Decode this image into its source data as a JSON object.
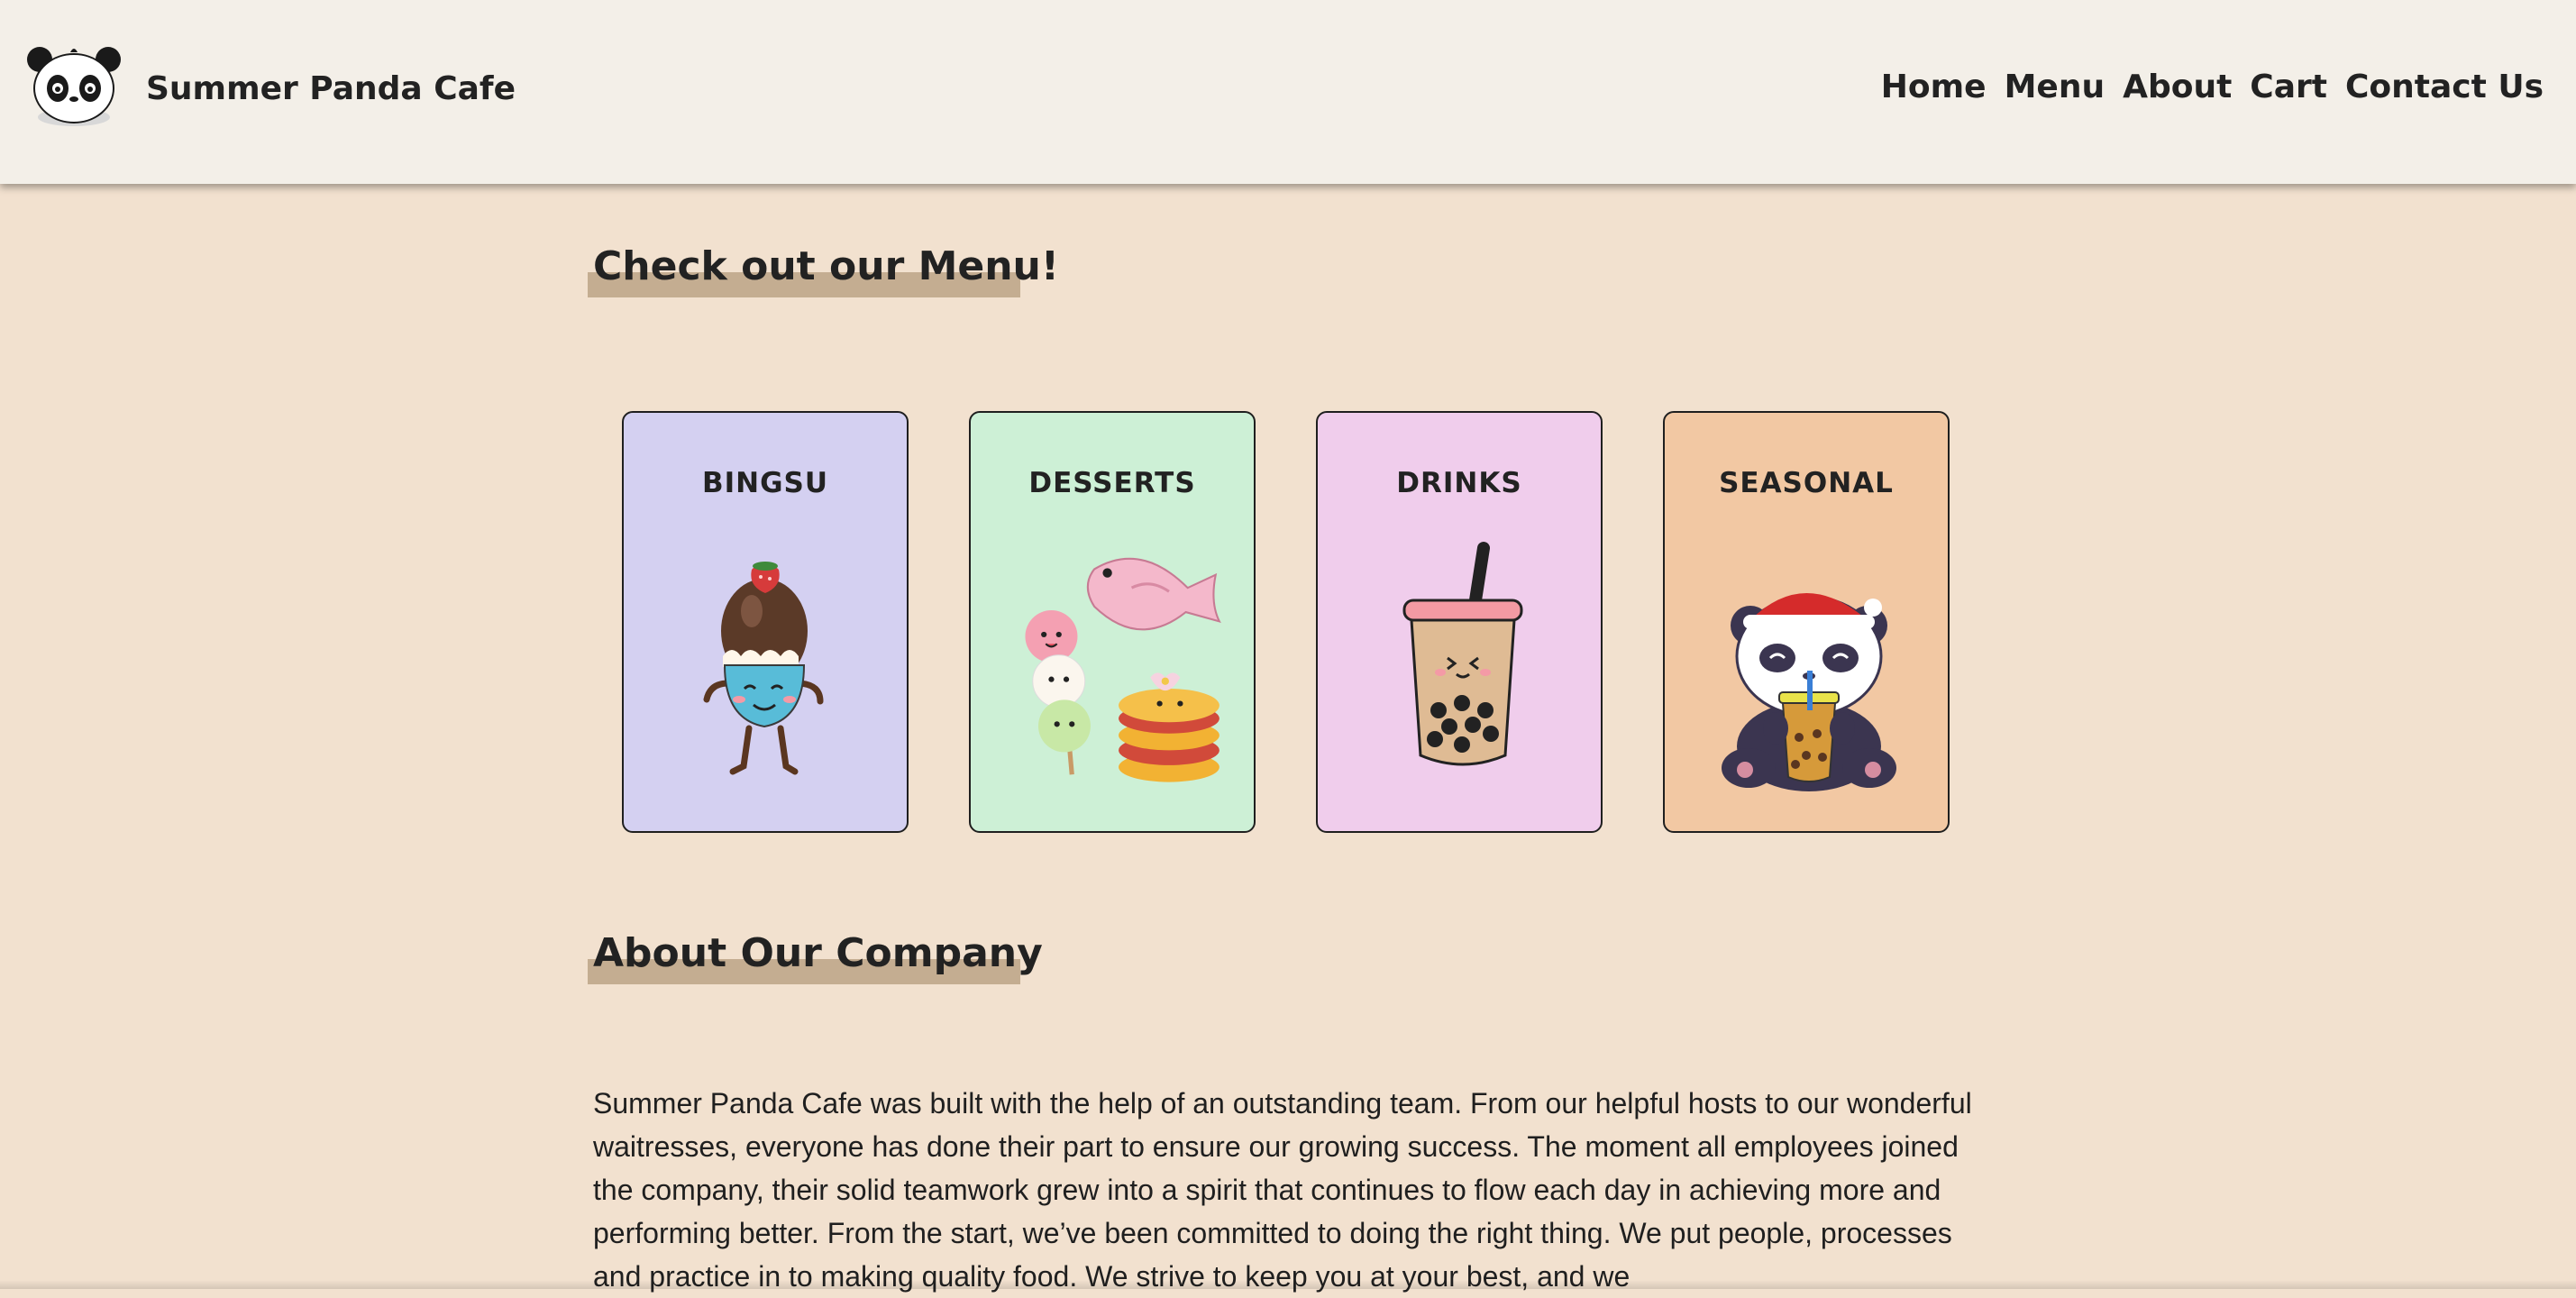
{
  "header": {
    "brand": "Summer Panda Cafe",
    "nav": [
      "Home",
      "Menu",
      "About",
      "Cart",
      "Contact Us"
    ]
  },
  "menu_section": {
    "title": "Check out our Menu!",
    "cards": [
      {
        "label": "BINGSU",
        "icon": "bingsu-icon",
        "color": "#d4d0f1"
      },
      {
        "label": "DESSERTS",
        "icon": "desserts-icon",
        "color": "#cdf0d6"
      },
      {
        "label": "DRINKS",
        "icon": "drinks-icon",
        "color": "#f0cdec"
      },
      {
        "label": "SEASONAL",
        "icon": "seasonal-icon",
        "color": "#f2c8a3"
      }
    ]
  },
  "about_section": {
    "title": "About Our Company",
    "text": "Summer Panda Cafe was built with the help of an outstanding team. From our helpful hosts to our wonderful waitresses, everyone has done their part to ensure our growing success. The moment all employees joined the company, their solid teamwork grew into a spirit that continues to flow each day in achieving more and performing better. From the start, we’ve been committed to doing the right thing. We put people, processes and practice in to making quality food. We strive to keep you at your best, and we"
  },
  "colors": {
    "page_background": "#f2e1cf",
    "navbar_background": "#f3efe8",
    "title_underline": "#c4ad91"
  }
}
